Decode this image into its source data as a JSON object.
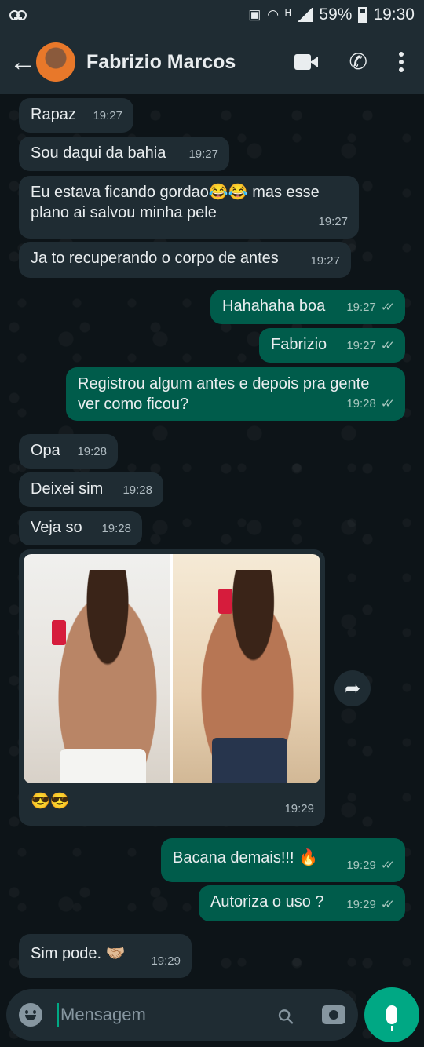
{
  "status_bar": {
    "battery": "59%",
    "time": "19:30"
  },
  "header": {
    "contact_name": "Fabrizio Marcos"
  },
  "messages": [
    {
      "dir": "in",
      "text": "Rapaz",
      "time": "19:27"
    },
    {
      "dir": "in",
      "text": "Sou daqui da bahia",
      "time": "19:27"
    },
    {
      "dir": "in",
      "text": "Eu estava ficando gordao😂😂 mas esse\nplano ai salvou minha pele",
      "time": "19:27"
    },
    {
      "dir": "in",
      "text": "Ja to recuperando o corpo de antes",
      "time": "19:27"
    },
    {
      "dir": "out",
      "text": "Hahahaha boa",
      "time": "19:27"
    },
    {
      "dir": "out",
      "text": "Fabrizio",
      "time": "19:27"
    },
    {
      "dir": "out",
      "text": "Registrou algum antes e depois pra gente\nver como ficou?",
      "time": "19:28"
    },
    {
      "dir": "in",
      "text": "Opa",
      "time": "19:28"
    },
    {
      "dir": "in",
      "text": "Deixei sim",
      "time": "19:28"
    },
    {
      "dir": "in",
      "text": "Veja so",
      "time": "19:28"
    },
    {
      "dir": "in",
      "text": "😎😎",
      "time": "19:29",
      "has_image": true
    },
    {
      "dir": "out",
      "text": "Bacana demais!!! 🔥",
      "time": "19:29"
    },
    {
      "dir": "out",
      "text": "Autoriza o uso ?",
      "time": "19:29"
    },
    {
      "dir": "in",
      "text": "Sim pode. 🤝🏼",
      "time": "19:29"
    }
  ],
  "composer": {
    "placeholder": "Mensagem"
  },
  "icons": {
    "back": "arrow-left",
    "video": "video-camera",
    "call": "phone",
    "menu": "vertical-dots",
    "share": "forward-arrow",
    "emoji": "smiley",
    "attach": "paperclip",
    "camera": "camera",
    "mic": "microphone"
  },
  "colors": {
    "incoming_bubble": "#1f2c33",
    "outgoing_bubble": "#005c4b",
    "accent": "#00a884",
    "header": "#1f2c33",
    "background": "#0b1418"
  }
}
